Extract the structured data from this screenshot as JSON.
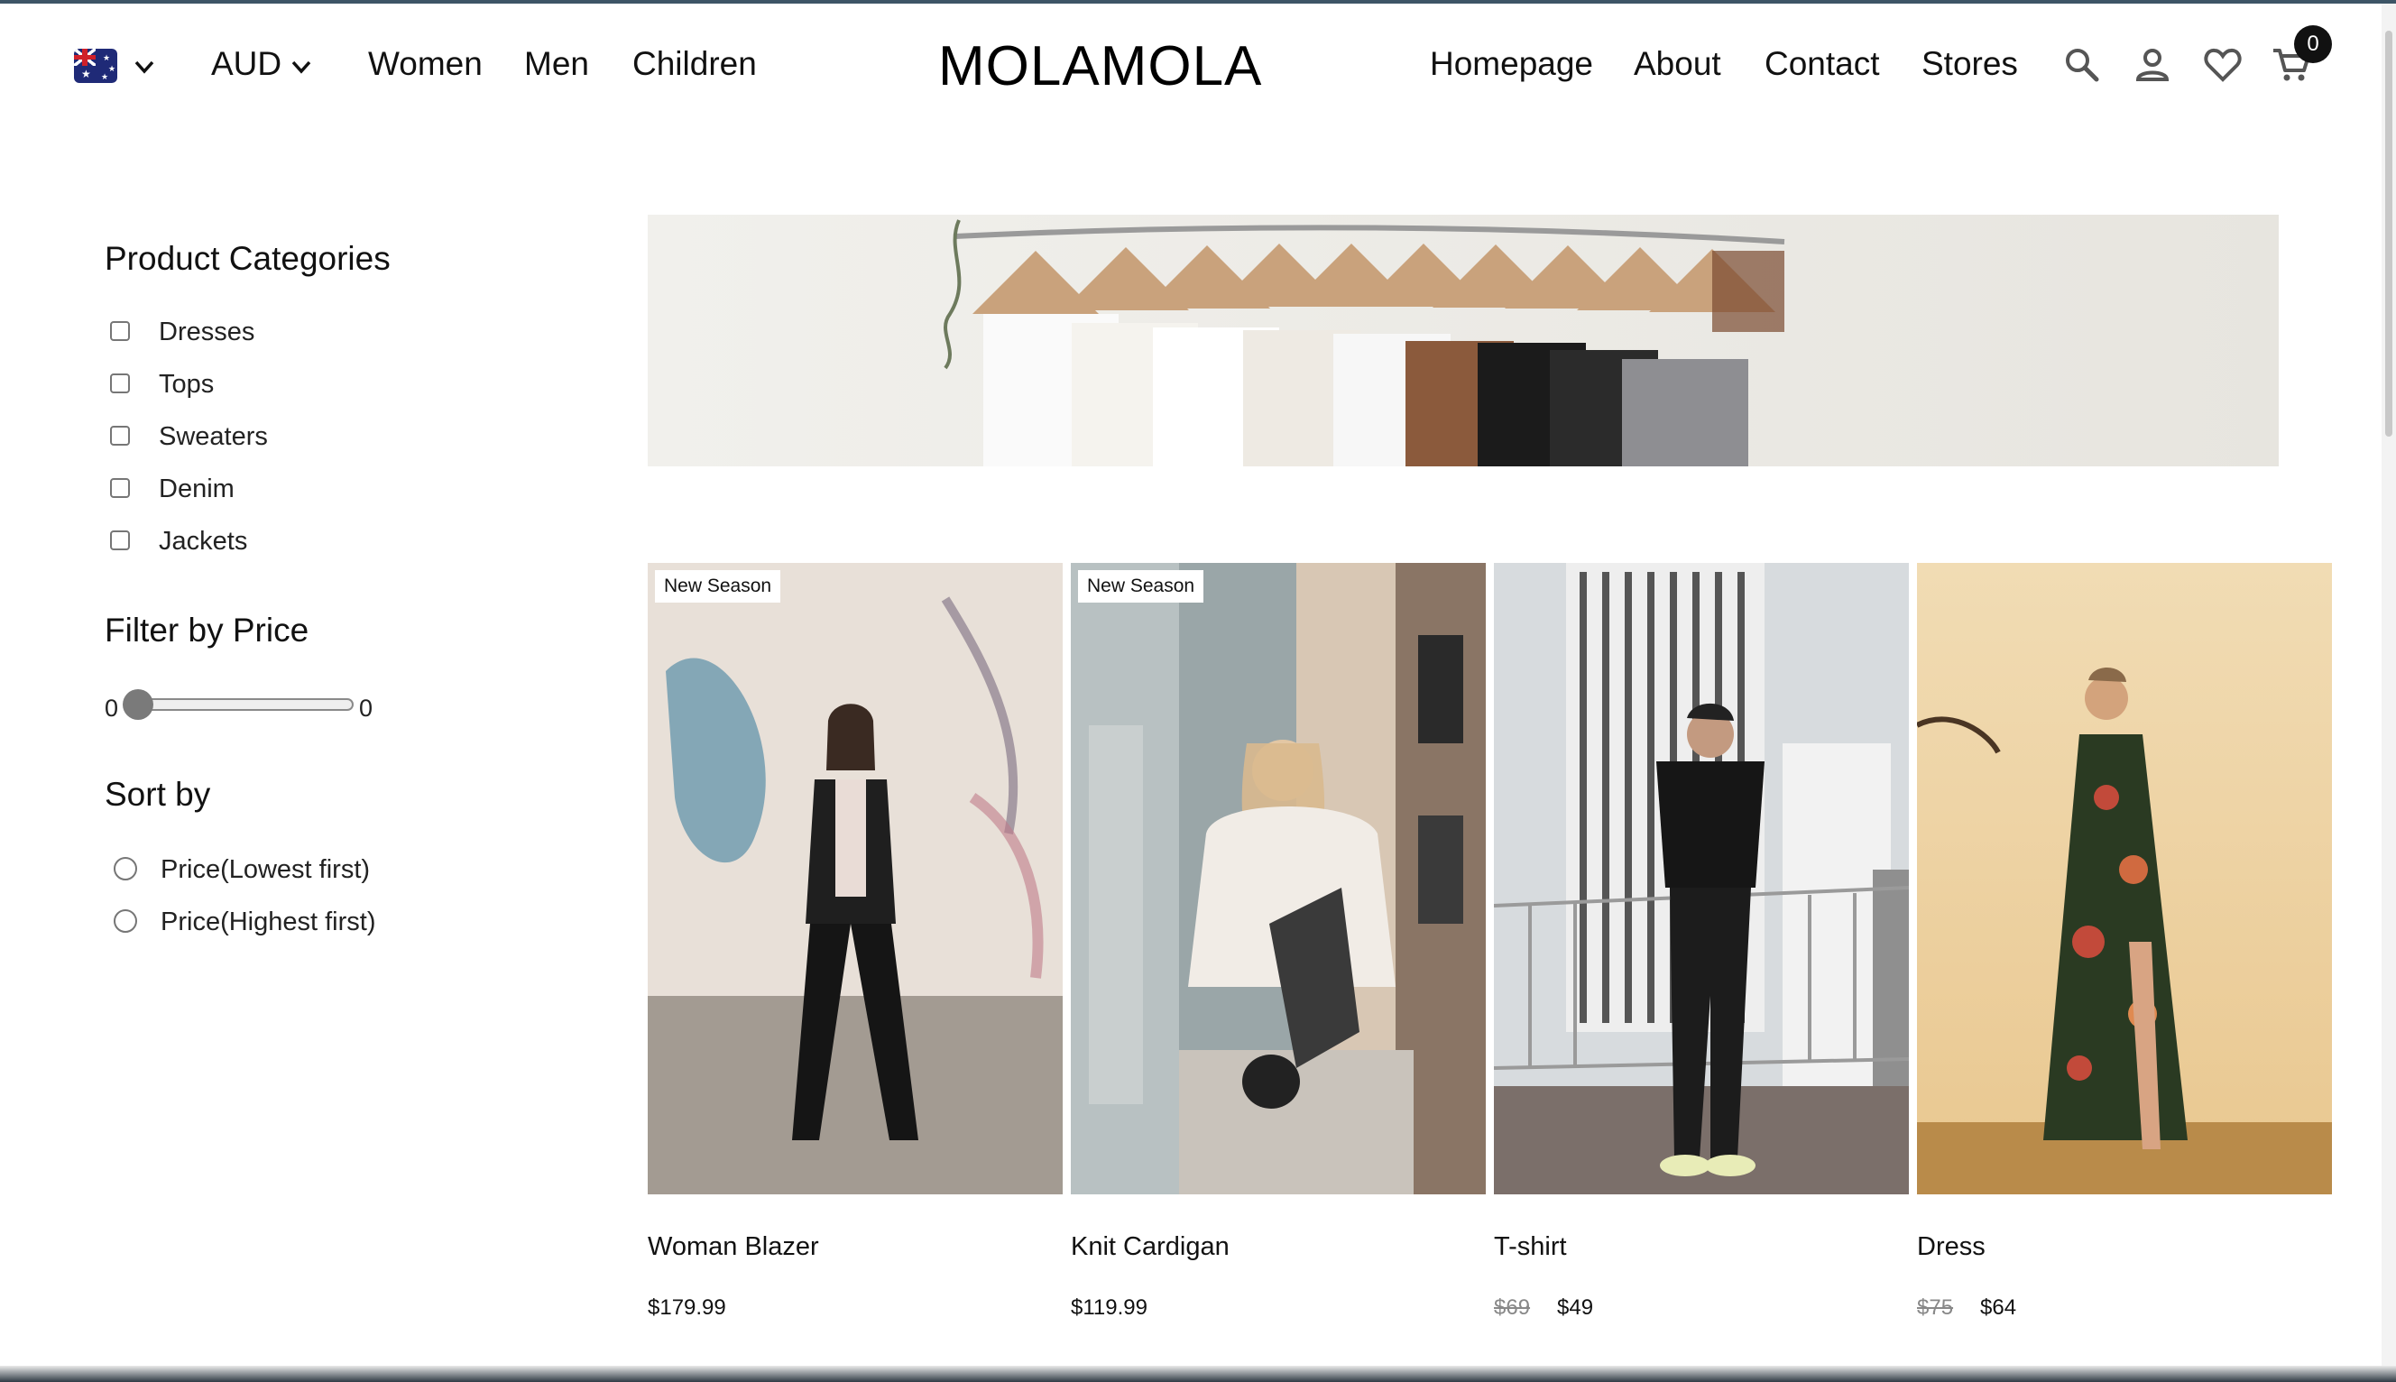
{
  "header": {
    "currency": "AUD",
    "nav_left": [
      "Women",
      "Men",
      "Children"
    ],
    "logo": "MOLAMOLA",
    "nav_right": [
      "Homepage",
      "About",
      "Contact",
      "Stores"
    ],
    "cart_count": "0",
    "icons": [
      "australia-flag-icon",
      "chevron-down-icon",
      "search-icon",
      "user-icon",
      "heart-icon",
      "cart-icon"
    ]
  },
  "sidebar": {
    "categories_title": "Product Categories",
    "categories": [
      "Dresses",
      "Tops",
      "Sweaters",
      "Denim",
      "Jackets"
    ],
    "price_title": "Filter by Price",
    "price_min": "0",
    "price_max": "0",
    "price_slider_level": 0,
    "sort_title": "Sort by",
    "sort_options": [
      "Price(Lowest first)",
      "Price(Highest first)"
    ]
  },
  "products": [
    {
      "name": "Woman Blazer",
      "price": "$179.99",
      "badge": "New Season"
    },
    {
      "name": "Knit Cardigan",
      "price": "$119.99",
      "badge": "New Season"
    },
    {
      "name": "T-shirt",
      "old_price": "$69",
      "price": "$49"
    },
    {
      "name": "Dress",
      "old_price": "$75",
      "price": "$64"
    }
  ],
  "colors": {
    "text": "#111111",
    "badge_bg": "#ffffff",
    "cart_badge_bg": "#111111",
    "top_border": "#3d5566"
  }
}
